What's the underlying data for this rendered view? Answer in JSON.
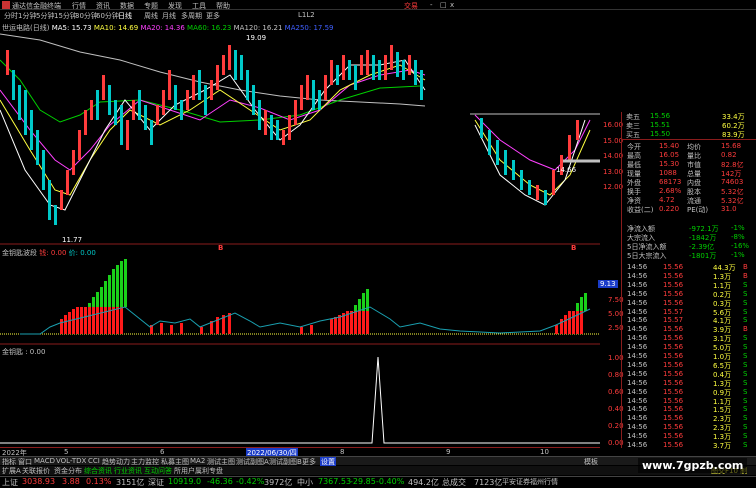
{
  "titlebar": {
    "app": "通达信金融终端",
    "menu": [
      "行情",
      "资讯",
      "数据",
      "专题",
      "发现",
      "工具",
      "帮助"
    ],
    "right": "交易",
    "winbtns": [
      "-",
      "□",
      "x"
    ]
  },
  "period_tabs": [
    "分时",
    "1分钟",
    "5分钟",
    "15分钟",
    "30分钟",
    "60分钟",
    "日线",
    "周线",
    "月线",
    "多周期",
    "更多"
  ],
  "period_right": "L1L2",
  "main_chart": {
    "stock": "世运电路(日线)",
    "ma": [
      {
        "label": "MA5: 15.73",
        "color": "#ffffff"
      },
      {
        "label": "MA10: 14.69",
        "color": "#ffff40"
      },
      {
        "label": "MA20: 14.36",
        "color": "#ff40ff"
      },
      {
        "label": "MA60: 16.23",
        "color": "#00d000"
      },
      {
        "label": "MA120: 16.21",
        "color": "#c0c0c0"
      },
      {
        "label": "MA250: 17.59",
        "color": "#4060ff"
      }
    ],
    "high_mark": "19.09",
    "low_mark": "11.77",
    "right_mark": "14.66",
    "axis": [
      "16.00",
      "15.00",
      "14.00",
      "13.00",
      "12.00"
    ],
    "mini_marks": [
      "B",
      "B"
    ]
  },
  "quote": {
    "ask5": {
      "label": "卖五",
      "price": "15.56",
      "vol": "33.4万"
    },
    "ask3": {
      "label": "卖三",
      "price": "15.51",
      "vol": "60.2万"
    },
    "ask1": {
      "label": "买五",
      "price": "15.50",
      "vol": "83.9万"
    },
    "rows": [
      {
        "k": "今开",
        "v": "15.40",
        "k2": "均价",
        "v2": "15.68"
      },
      {
        "k": "最高",
        "v": "16.05",
        "k2": "量比",
        "v2": "0.82"
      },
      {
        "k": "最低",
        "v": "15.30",
        "k2": "市值",
        "v2": "82.8亿"
      },
      {
        "k": "现量",
        "v": "1088",
        "k2": "总量",
        "v2": "142万"
      },
      {
        "k": "外盘",
        "v": "68173",
        "k2": "内盘",
        "v2": "74603"
      },
      {
        "k": "换手",
        "v": "2.68%",
        "k2": "股本",
        "v2": "5.32亿"
      },
      {
        "k": "净资",
        "v": "4.72",
        "k2": "流通",
        "v2": "5.32亿"
      },
      {
        "k": "收益(二)",
        "v": "0.220",
        "k2": "PE(动)",
        "v2": "31.0"
      }
    ],
    "flows": [
      {
        "k": "净流入额",
        "v": "-972.1万",
        "p": "-1%"
      },
      {
        "k": "大宗流入",
        "v": "-1842万",
        "p": "-8%"
      },
      {
        "k": "5日净流入额",
        "v": "-2.39亿",
        "p": "-16%"
      },
      {
        "k": "5日大宗流入",
        "v": "-1801万",
        "p": "-1%"
      }
    ]
  },
  "ticks": [
    {
      "t": "14:56",
      "p": "15.56",
      "v": "44.3万",
      "d": "B"
    },
    {
      "t": "14:56",
      "p": "15.56",
      "v": "1.3万",
      "d": "B"
    },
    {
      "t": "14:56",
      "p": "15.56",
      "v": "1.1万",
      "d": "S"
    },
    {
      "t": "14:56",
      "p": "15.56",
      "v": "0.2万",
      "d": "S"
    },
    {
      "t": "14:56",
      "p": "15.56",
      "v": "0.3万",
      "d": "S"
    },
    {
      "t": "14:56",
      "p": "15.57",
      "v": "5.6万",
      "d": "S"
    },
    {
      "t": "14:56",
      "p": "15.57",
      "v": "4.1万",
      "d": "S"
    },
    {
      "t": "14:56",
      "p": "15.56",
      "v": "3.9万",
      "d": "B"
    },
    {
      "t": "14:56",
      "p": "15.56",
      "v": "3.1万",
      "d": "S"
    },
    {
      "t": "14:56",
      "p": "15.56",
      "v": "5.0万",
      "d": "S"
    },
    {
      "t": "14:56",
      "p": "15.56",
      "v": "1.0万",
      "d": "S"
    },
    {
      "t": "14:56",
      "p": "15.56",
      "v": "6.5万",
      "d": "S"
    },
    {
      "t": "14:56",
      "p": "15.56",
      "v": "0.4万",
      "d": "S"
    },
    {
      "t": "14:56",
      "p": "15.56",
      "v": "1.3万",
      "d": "S"
    },
    {
      "t": "14:56",
      "p": "15.56",
      "v": "0.9万",
      "d": "S"
    },
    {
      "t": "14:56",
      "p": "15.56",
      "v": "1.1万",
      "d": "S"
    },
    {
      "t": "14:56",
      "p": "15.56",
      "v": "1.5万",
      "d": "S"
    },
    {
      "t": "14:56",
      "p": "15.56",
      "v": "2.3万",
      "d": "S"
    },
    {
      "t": "14:56",
      "p": "15.56",
      "v": "2.3万",
      "d": "S"
    },
    {
      "t": "14:56",
      "p": "15.56",
      "v": "1.3万",
      "d": "S"
    },
    {
      "t": "14:56",
      "p": "15.56",
      "v": "3.7万",
      "d": "S"
    }
  ],
  "ind1": {
    "title": "金钥匙波段",
    "v1": "钱: 0.00",
    "v2": "价: 0.00",
    "axis": [
      "9.13",
      "7.50",
      "5.00",
      "2.50"
    ]
  },
  "ind2": {
    "title": "金钥匙 : 0.00",
    "axis": [
      "1.00",
      "0.80",
      "0.60",
      "0.40",
      "0.20",
      "0.00"
    ]
  },
  "xaxis": {
    "left": "2022年",
    "date": "2022/06/30/四",
    "labels": [
      "5",
      "6",
      "8",
      "9",
      "10"
    ]
  },
  "bottom_tabs": [
    "指标",
    "窗口",
    "MACD",
    "VOL-TDX",
    "CCI",
    "趋势动力",
    "主力监控",
    "私募主图",
    "MA2",
    "测试主图",
    "测试副图A",
    "测试副图B",
    "更多",
    "设置"
  ],
  "bottom_tabs_right": "模板",
  "link_row": [
    "扩展A",
    "关联报价",
    "资金分布",
    "综合资讯",
    "行业资讯",
    "互动问答",
    "所用户属利专盘"
  ],
  "link_row_right": "图交F10 制",
  "statusbar": [
    {
      "name": "上证",
      "val": "3038.93",
      "chg": "3.88",
      "pct": "0.13%",
      "amt": "3151亿"
    },
    {
      "name": "深证",
      "val": "10919.0",
      "chg": "-46.36",
      "pct": "-0.42%",
      "amt": "3972亿"
    },
    {
      "name": "中小",
      "val": "7367.53",
      "chg": "-29.85",
      "pct": "-0.40%",
      "amt": "494.2亿"
    }
  ],
  "status_right": {
    "label": "总成交",
    "amt": "7123亿",
    "broker": "平安证券福州行情"
  },
  "watermark": "www.7gpzb.com"
}
